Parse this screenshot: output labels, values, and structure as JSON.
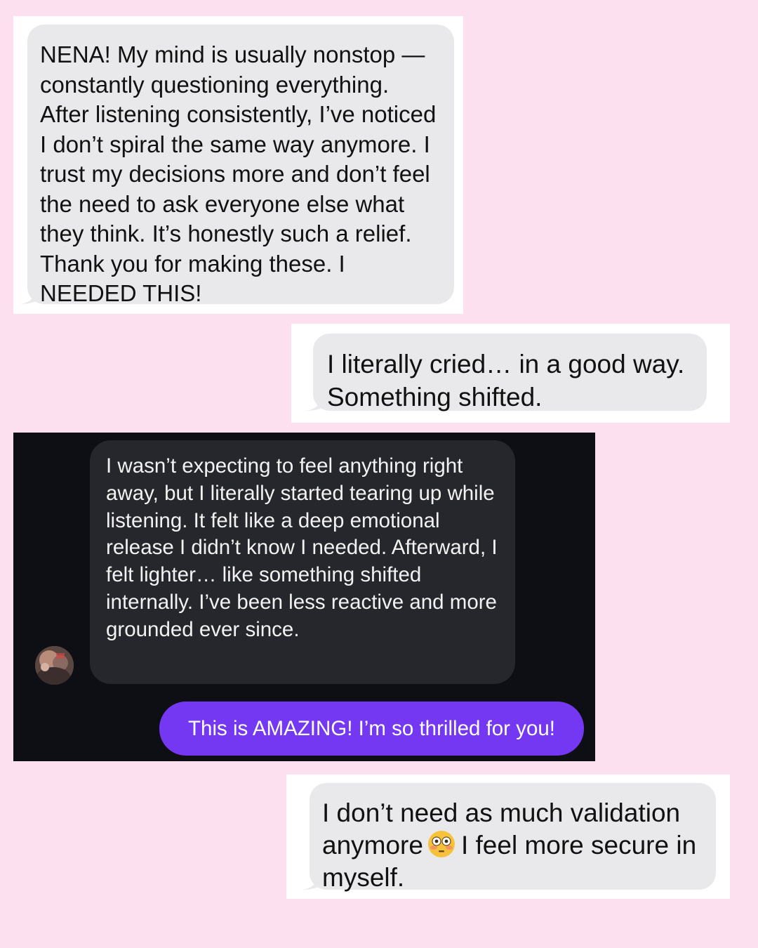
{
  "messages": [
    {
      "text": "NENA! My mind is usually nonstop — constantly questioning everything. After listening consistently, I’ve noticed I don’t spiral the same way anymore. I trust my decisions more and don’t feel the need to ask everyone else what they think. It’s honestly such a relief. Thank you for making these. I NEEDED THIS!"
    },
    {
      "text": "I literally cried… in a good way. Something shifted."
    },
    {
      "text": "I wasn’t expecting to feel anything right away, but I literally started tearing up while listening. It felt like a deep emotional release I didn’t know I needed. Afterward, I felt lighter… like something shifted internally. I’ve been less reactive and more grounded ever since."
    },
    {
      "text": "This is AMAZING! I’m so thrilled for you!"
    },
    {
      "text_before_emoji": "I don’t need as much validation anymore",
      "emoji": "flushed-face-emoji",
      "text_after_emoji": "I feel more secure in myself."
    }
  ],
  "colors": {
    "page_background": "#fde0ef",
    "light_bubble": "#e9e9eb",
    "dark_background": "#0e0f14",
    "dark_bubble": "#26272c",
    "sent_bubble": "#7438f2"
  }
}
